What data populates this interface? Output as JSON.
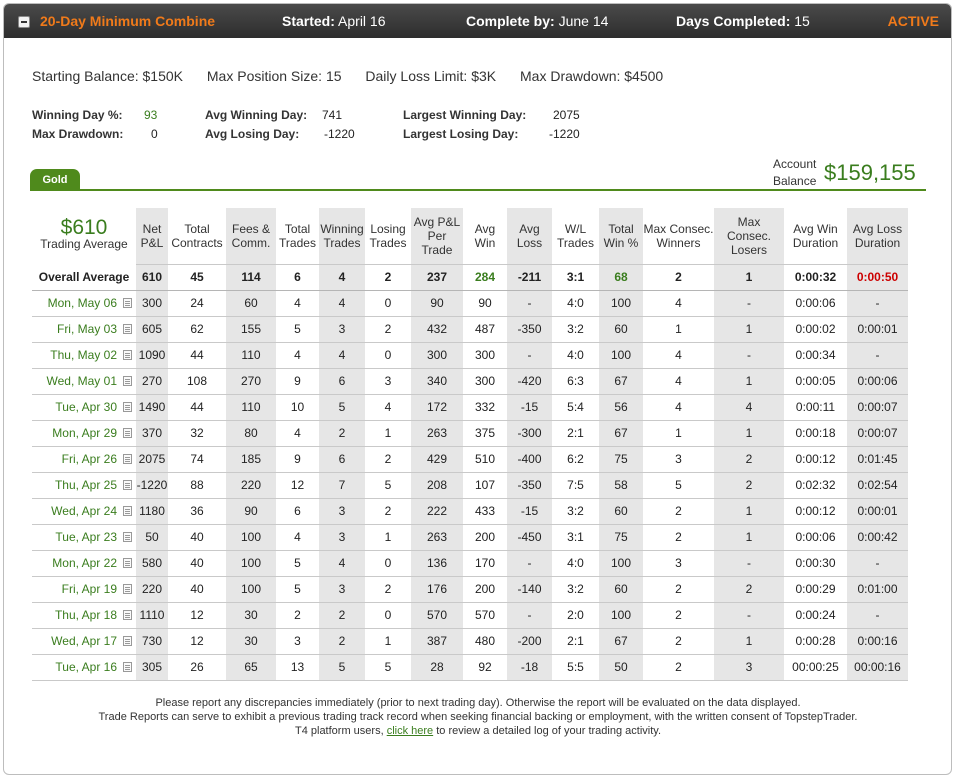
{
  "header": {
    "title": "20-Day Minimum Combine",
    "started_label": "Started:",
    "started_value": "April 16",
    "complete_label": "Complete by:",
    "complete_value": "June 14",
    "days_label": "Days Completed:",
    "days_value": "15",
    "status": "ACTIVE"
  },
  "summary": {
    "starting_balance": "Starting Balance: $150K",
    "max_position": "Max Position Size: 15",
    "daily_loss": "Daily Loss Limit: $3K",
    "max_drawdown": "Max Drawdown: $4500"
  },
  "stats": {
    "winning_day_pct_label": "Winning Day %:",
    "winning_day_pct": "93",
    "max_drawdown_label": "Max Drawdown:",
    "max_drawdown": "0",
    "avg_winning_day_label": "Avg Winning Day:",
    "avg_winning_day": "741",
    "avg_losing_day_label": "Avg Losing Day:",
    "avg_losing_day": "-1220",
    "largest_winning_day_label": "Largest Winning Day:",
    "largest_winning_day": "2075",
    "largest_losing_day_label": "Largest Losing Day:",
    "largest_losing_day": "-1220"
  },
  "tab_label": "Gold",
  "account": {
    "label_line1": "Account",
    "label_line2": "Balance",
    "value": "$159,155"
  },
  "trading_average": {
    "value": "$610",
    "label": "Trading Average"
  },
  "columns": [
    "Net P&L",
    "Total Contracts",
    "Fees & Comm.",
    "Total Trades",
    "Winning Trades",
    "Losing Trades",
    "Avg P&L Per Trade",
    "Avg Win",
    "Avg Loss",
    "W/L Trades",
    "Total Win %",
    "Max Consec. Winners",
    "Max Consec. Losers",
    "Avg Win Duration",
    "Avg Loss Duration"
  ],
  "overall": {
    "label": "Overall Average",
    "values": [
      "610",
      "45",
      "114",
      "6",
      "4",
      "2",
      "237",
      "284",
      "-211",
      "3:1",
      "68",
      "2",
      "1",
      "0:00:32",
      "0:00:50"
    ]
  },
  "rows": [
    {
      "date": "Mon, May 06",
      "values": [
        "300",
        "24",
        "60",
        "4",
        "4",
        "0",
        "90",
        "90",
        "-",
        "4:0",
        "100",
        "4",
        "-",
        "0:00:06",
        "-"
      ]
    },
    {
      "date": "Fri, May 03",
      "values": [
        "605",
        "62",
        "155",
        "5",
        "3",
        "2",
        "432",
        "487",
        "-350",
        "3:2",
        "60",
        "1",
        "1",
        "0:00:02",
        "0:00:01"
      ]
    },
    {
      "date": "Thu, May 02",
      "values": [
        "1090",
        "44",
        "110",
        "4",
        "4",
        "0",
        "300",
        "300",
        "-",
        "4:0",
        "100",
        "4",
        "-",
        "0:00:34",
        "-"
      ]
    },
    {
      "date": "Wed, May 01",
      "values": [
        "270",
        "108",
        "270",
        "9",
        "6",
        "3",
        "340",
        "300",
        "-420",
        "6:3",
        "67",
        "4",
        "1",
        "0:00:05",
        "0:00:06"
      ]
    },
    {
      "date": "Tue, Apr 30",
      "values": [
        "1490",
        "44",
        "110",
        "10",
        "5",
        "4",
        "172",
        "332",
        "-15",
        "5:4",
        "56",
        "4",
        "4",
        "0:00:11",
        "0:00:07"
      ]
    },
    {
      "date": "Mon, Apr 29",
      "values": [
        "370",
        "32",
        "80",
        "4",
        "2",
        "1",
        "263",
        "375",
        "-300",
        "2:1",
        "67",
        "1",
        "1",
        "0:00:18",
        "0:00:07"
      ]
    },
    {
      "date": "Fri, Apr 26",
      "values": [
        "2075",
        "74",
        "185",
        "9",
        "6",
        "2",
        "429",
        "510",
        "-400",
        "6:2",
        "75",
        "3",
        "2",
        "0:00:12",
        "0:01:45"
      ]
    },
    {
      "date": "Thu, Apr 25",
      "values": [
        "-1220",
        "88",
        "220",
        "12",
        "7",
        "5",
        "208",
        "107",
        "-350",
        "7:5",
        "58",
        "5",
        "2",
        "0:02:32",
        "0:02:54"
      ]
    },
    {
      "date": "Wed, Apr 24",
      "values": [
        "1180",
        "36",
        "90",
        "6",
        "3",
        "2",
        "222",
        "433",
        "-15",
        "3:2",
        "60",
        "2",
        "1",
        "0:00:12",
        "0:00:01"
      ]
    },
    {
      "date": "Tue, Apr 23",
      "values": [
        "50",
        "40",
        "100",
        "4",
        "3",
        "1",
        "263",
        "200",
        "-450",
        "3:1",
        "75",
        "2",
        "1",
        "0:00:06",
        "0:00:42"
      ]
    },
    {
      "date": "Mon, Apr 22",
      "values": [
        "580",
        "40",
        "100",
        "5",
        "4",
        "0",
        "136",
        "170",
        "-",
        "4:0",
        "100",
        "3",
        "-",
        "0:00:30",
        "-"
      ]
    },
    {
      "date": "Fri, Apr 19",
      "values": [
        "220",
        "40",
        "100",
        "5",
        "3",
        "2",
        "176",
        "200",
        "-140",
        "3:2",
        "60",
        "2",
        "2",
        "0:00:29",
        "0:01:00"
      ]
    },
    {
      "date": "Thu, Apr 18",
      "values": [
        "1110",
        "12",
        "30",
        "2",
        "2",
        "0",
        "570",
        "570",
        "-",
        "2:0",
        "100",
        "2",
        "-",
        "0:00:24",
        "-"
      ]
    },
    {
      "date": "Wed, Apr 17",
      "values": [
        "730",
        "12",
        "30",
        "3",
        "2",
        "1",
        "387",
        "480",
        "-200",
        "2:1",
        "67",
        "2",
        "1",
        "0:00:28",
        "0:00:16"
      ]
    },
    {
      "date": "Tue, Apr 16",
      "values": [
        "305",
        "26",
        "65",
        "13",
        "5",
        "5",
        "28",
        "92",
        "-18",
        "5:5",
        "50",
        "2",
        "3",
        "00:00:25",
        "00:00:16"
      ]
    }
  ],
  "footer": {
    "line1": "Please report any discrepancies immediately (prior to next trading day). Otherwise the report will be evaluated on the data displayed.",
    "line2": "Trade Reports can serve to exhibit a previous trading track record when seeking financial backing or employment, with the written consent of TopstepTrader.",
    "line3_pre": "T4 platform users, ",
    "line3_link": "click here",
    "line3_post": " to review a detailed log of your trading activity."
  },
  "colors": {
    "accent": "#f07a1a",
    "green": "#3a7d1e",
    "tab_green": "#4f8a1c",
    "loss_red": "#cc0000"
  },
  "icons": {
    "collapse": "minus-square-icon",
    "day_report": "document-icon"
  }
}
